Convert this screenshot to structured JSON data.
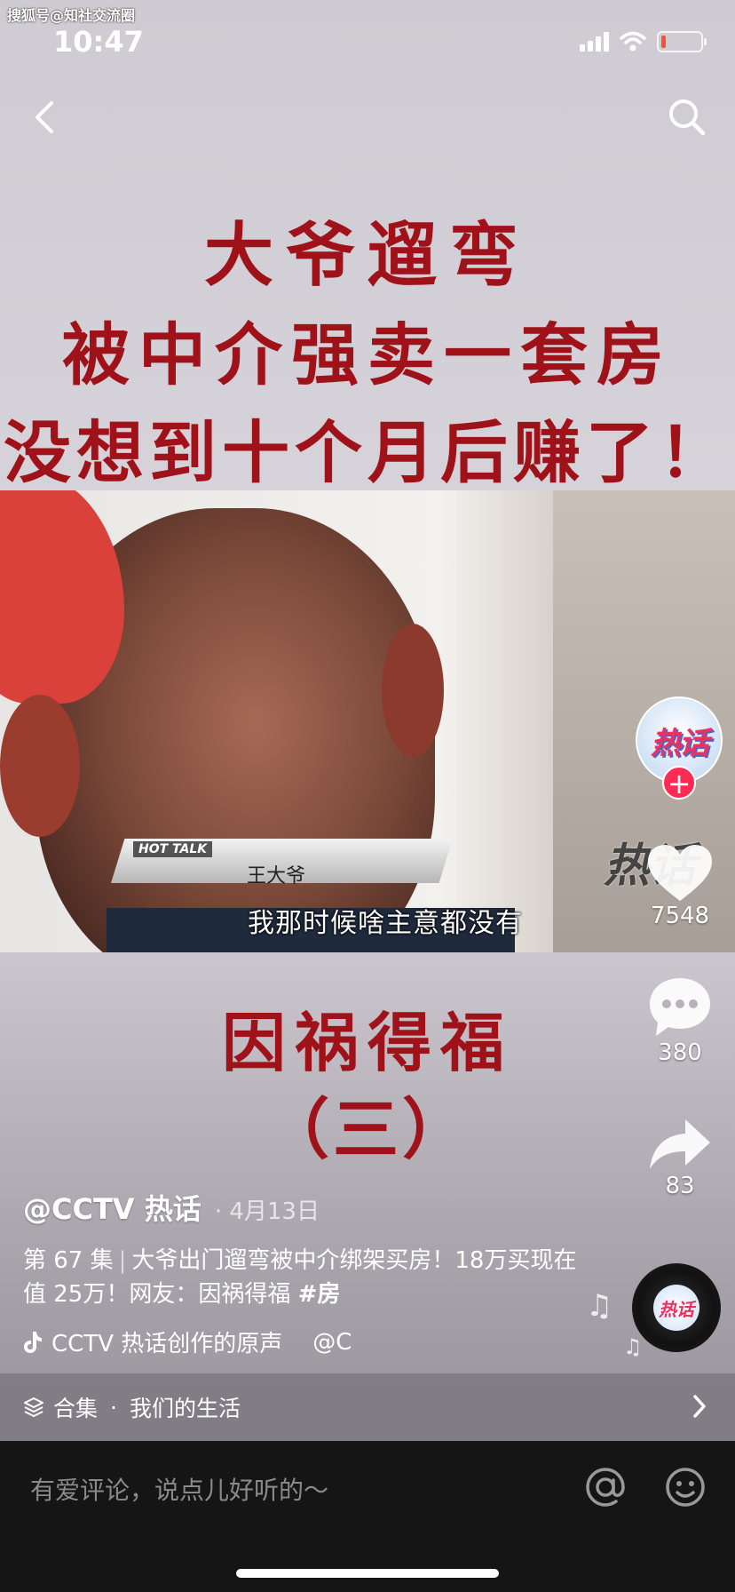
{
  "watermark": "搜狐号@知社交流圈",
  "status": {
    "time": "10:47"
  },
  "video": {
    "headline": [
      "大爷遛弯",
      "被中介强卖一套房",
      "没想到十个月后赚了！"
    ],
    "hot_tag": "HOT TALK",
    "name_tag": "王大爷",
    "subtitle": "我那时候啥主意都没有",
    "corner_logo": "热话",
    "episode_title": "因祸得福",
    "episode_part": "（三）"
  },
  "actions": {
    "avatar_logo": "热话",
    "follow_label": "+",
    "likes": "7548",
    "comments": "380",
    "shares": "83"
  },
  "meta": {
    "author": "@CCTV 热话",
    "date": "· 4月13日",
    "episode": "第 67 集",
    "description": "大爷出门遛弯被中介绑架买房！18万买现在值 25万！网友：因祸得福",
    "hashtag": "#房",
    "music": "CCTV 热话创作的原声",
    "music_tail": "@C"
  },
  "collection": {
    "label": "合集",
    "name": "我们的生活"
  },
  "comment": {
    "placeholder": "有爱评论，说点儿好听的～"
  },
  "colors": {
    "headline_red": "#a0121a",
    "follow_red": "#fe2c55"
  }
}
